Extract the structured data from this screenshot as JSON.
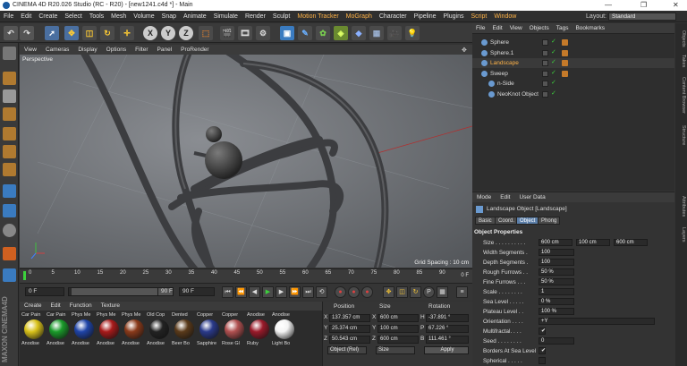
{
  "window": {
    "title": "CINEMA 4D R20.026 Studio (RC - R20) - [new1241.c4d *] - Main",
    "min": "—",
    "max": "❐",
    "close": "✕"
  },
  "menubar": {
    "items": [
      "File",
      "Edit",
      "Create",
      "Select",
      "Tools",
      "Mesh",
      "Volume",
      "Snap",
      "Animate",
      "Simulate",
      "Render",
      "Sculpt",
      "Motion Tracker",
      "MoGraph",
      "Character",
      "Pipeline",
      "Plugins",
      "Script",
      "Window"
    ],
    "layout_label": "Layout:",
    "layout_value": "Standard"
  },
  "toolbar": {
    "axis_x": "X",
    "axis_y": "Y",
    "axis_z": "Z"
  },
  "viewport": {
    "menu": [
      "View",
      "Cameras",
      "Display",
      "Options",
      "Filter",
      "Panel",
      "ProRender"
    ],
    "camera_label": "Perspective",
    "grid_spacing": "Grid Spacing : 10 cm"
  },
  "timeline": {
    "ticks": [
      "0",
      "5",
      "10",
      "15",
      "20",
      "25",
      "30",
      "35",
      "40",
      "45",
      "50",
      "55",
      "60",
      "65",
      "70",
      "75",
      "80",
      "85",
      "90"
    ],
    "frame_end_marker": "0 F"
  },
  "playback": {
    "current_frame": "0 F",
    "min_frame": "0 F",
    "max_frame": "90 F",
    "end_frame": "90 F"
  },
  "material_manager": {
    "menu": [
      "Create",
      "Edit",
      "Function",
      "Texture"
    ],
    "materials": [
      {
        "top": "Car Pain",
        "bottom": "Anodise",
        "color": "#d9c21a"
      },
      {
        "top": "Car Pain",
        "bottom": "Anodise",
        "color": "#1a9a2a"
      },
      {
        "top": "Phys Me",
        "bottom": "Anodise",
        "color": "#1f44a8"
      },
      {
        "top": "Phys Me",
        "bottom": "Anodise",
        "color": "#a81a1a"
      },
      {
        "top": "Phys Me",
        "bottom": "Anodise",
        "color": "#8a3a1a"
      },
      {
        "top": "Old Cop",
        "bottom": "Anodise",
        "color": "#222222"
      },
      {
        "top": "Dented",
        "bottom": "Beer Bo",
        "color": "#5a3a1a"
      },
      {
        "top": "Copper",
        "bottom": "Sapphire",
        "color": "#2a3a8a"
      },
      {
        "top": "Copper",
        "bottom": "Rose Gl",
        "color": "#b05050"
      },
      {
        "top": "Anodise",
        "bottom": "Ruby",
        "color": "#9a1a2a"
      },
      {
        "top": "Anodise",
        "bottom": "Light Bo",
        "color": "#f4f4f4"
      }
    ]
  },
  "coordinates": {
    "headers": {
      "position": "Position",
      "size": "Size",
      "rotation": "Rotation"
    },
    "rows": [
      {
        "axis": "X",
        "pos": "137.357 cm",
        "size_axis": "X",
        "size": "600 cm",
        "rot_axis": "H",
        "rot": "-37.891 °"
      },
      {
        "axis": "Y",
        "pos": "25.374 cm",
        "size_axis": "Y",
        "size": "100 cm",
        "rot_axis": "P",
        "rot": "67.226 °"
      },
      {
        "axis": "Z",
        "pos": "50.543 cm",
        "size_axis": "Z",
        "size": "600 cm",
        "rot_axis": "B",
        "rot": "111.461 °"
      }
    ],
    "mode_select": "Object (Rel)",
    "size_select": "Size",
    "apply": "Apply"
  },
  "object_manager": {
    "menu": [
      "File",
      "Edit",
      "View",
      "Objects",
      "Tags",
      "Bookmarks"
    ],
    "objects": [
      {
        "name": "Sphere",
        "color": "#ddd",
        "indent": 0
      },
      {
        "name": "Sphere.1",
        "color": "#ddd",
        "indent": 0
      },
      {
        "name": "Landscape",
        "color": "#ffb347",
        "indent": 0
      },
      {
        "name": "Sweep",
        "color": "#ddd",
        "indent": 0
      },
      {
        "name": "n-Side",
        "color": "#ddd",
        "indent": 1
      },
      {
        "name": "NeoKnot Object",
        "color": "#ddd",
        "indent": 1
      }
    ]
  },
  "right_tabs": [
    "Objects",
    "Takes",
    "Content Browser",
    "Structure",
    "Attributes",
    "Layers"
  ],
  "attributes": {
    "menu": [
      "Mode",
      "Edit",
      "User Data"
    ],
    "object_title": "Landscape Object [Landscape]",
    "tabs": [
      "Basic",
      "Coord.",
      "Object",
      "Phong"
    ],
    "active_tab": "Object",
    "section": "Object Properties",
    "properties": [
      {
        "label": "Size . . . . . . . . . .",
        "values": [
          "600 cm",
          "100 cm",
          "600 cm"
        ]
      },
      {
        "label": "Width Segments .",
        "values": [
          "100"
        ]
      },
      {
        "label": "Depth Segments .",
        "values": [
          "100"
        ]
      },
      {
        "label": "Rough Furrows . .",
        "values": [
          "50 %"
        ]
      },
      {
        "label": "Fine Furrows . . .",
        "values": [
          "50 %"
        ]
      },
      {
        "label": "Scale . . . . . . . .",
        "values": [
          "1"
        ]
      },
      {
        "label": "Sea Level . . . . .",
        "values": [
          "0 %"
        ]
      },
      {
        "label": "Plateau Level . .",
        "values": [
          "100 %"
        ]
      },
      {
        "label": "Orientation . . . .",
        "values": [
          "+Y"
        ]
      },
      {
        "label": "Multifractal. . . .",
        "values": [
          "✔"
        ]
      },
      {
        "label": "Seed . . . . . . . .",
        "values": [
          "0"
        ]
      },
      {
        "label": "Borders At Sea Level",
        "values": [
          "✔"
        ]
      },
      {
        "label": "Spherical . . . . .",
        "values": [
          ""
        ]
      }
    ]
  }
}
